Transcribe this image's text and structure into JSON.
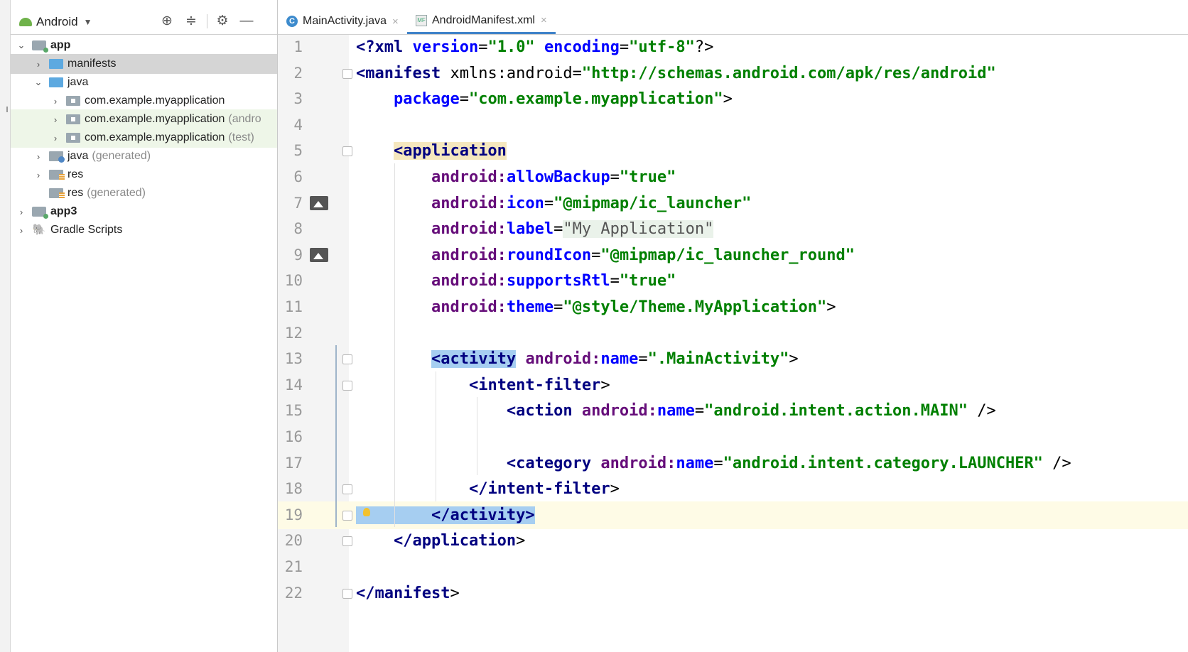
{
  "project_panel": {
    "view_selector": "Android",
    "tree": [
      {
        "label": "app",
        "suffix": "",
        "arrow": "⌄",
        "icon": "module-folder-icon",
        "bold": true,
        "state": "normal"
      },
      {
        "label": "manifests",
        "suffix": "",
        "arrow": "›",
        "icon": "manifests-folder-icon",
        "bold": false,
        "state": "selected"
      },
      {
        "label": "java",
        "suffix": "",
        "arrow": "⌄",
        "icon": "java-folder-icon",
        "bold": false,
        "state": "normal"
      },
      {
        "label": "com.example.myapplication",
        "suffix": "",
        "arrow": "›",
        "icon": "package-folder-icon",
        "bold": false,
        "state": "normal"
      },
      {
        "label": "com.example.myapplication",
        "suffix": "(andro",
        "arrow": "›",
        "icon": "package-folder-icon",
        "bold": false,
        "state": "tinted"
      },
      {
        "label": "com.example.myapplication",
        "suffix": "(test)",
        "arrow": "›",
        "icon": "package-folder-icon",
        "bold": false,
        "state": "tinted"
      },
      {
        "label": "java",
        "suffix": "(generated)",
        "arrow": "›",
        "icon": "generated-folder-icon",
        "bold": false,
        "state": "normal"
      },
      {
        "label": "res",
        "suffix": "",
        "arrow": "›",
        "icon": "res-folder-icon",
        "bold": false,
        "state": "normal"
      },
      {
        "label": "res",
        "suffix": "(generated)",
        "arrow": "",
        "icon": "res-folder-icon",
        "bold": false,
        "state": "normal"
      },
      {
        "label": "app3",
        "suffix": "",
        "arrow": "›",
        "icon": "module-folder-icon",
        "bold": true,
        "state": "normal"
      },
      {
        "label": "Gradle Scripts",
        "suffix": "",
        "arrow": "›",
        "icon": "gradle-icon",
        "bold": false,
        "state": "normal"
      }
    ]
  },
  "tabs": [
    {
      "label": "MainActivity.java",
      "icon": "C",
      "active": false
    },
    {
      "label": "AndroidManifest.xml",
      "icon": "MF",
      "active": true
    }
  ],
  "editor": {
    "current_line": 19,
    "lines": [
      {
        "n": "1",
        "code": "<?xml version=\"1.0\" encoding=\"utf-8\"?>"
      },
      {
        "n": "2",
        "code": "<manifest xmlns:android=\"http://schemas.android.com/apk/res/android\""
      },
      {
        "n": "3",
        "code": "    package=\"com.example.myapplication\">"
      },
      {
        "n": "4",
        "code": ""
      },
      {
        "n": "5",
        "code": "    <application"
      },
      {
        "n": "6",
        "code": "        android:allowBackup=\"true\""
      },
      {
        "n": "7",
        "code": "        android:icon=\"@mipmap/ic_launcher\""
      },
      {
        "n": "8",
        "code": "        android:label=\"My Application\""
      },
      {
        "n": "9",
        "code": "        android:roundIcon=\"@mipmap/ic_launcher_round\""
      },
      {
        "n": "10",
        "code": "        android:supportsRtl=\"true\""
      },
      {
        "n": "11",
        "code": "        android:theme=\"@style/Theme.MyApplication\">"
      },
      {
        "n": "12",
        "code": ""
      },
      {
        "n": "13",
        "code": "        <activity android:name=\".MainActivity\">"
      },
      {
        "n": "14",
        "code": "            <intent-filter>"
      },
      {
        "n": "15",
        "code": "                <action android:name=\"android.intent.action.MAIN\" />"
      },
      {
        "n": "16",
        "code": ""
      },
      {
        "n": "17",
        "code": "                <category android:name=\"android.intent.category.LAUNCHER\" />"
      },
      {
        "n": "18",
        "code": "            </intent-filter>"
      },
      {
        "n": "19",
        "code": "        </activity>"
      },
      {
        "n": "20",
        "code": "    </application>"
      },
      {
        "n": "21",
        "code": ""
      },
      {
        "n": "22",
        "code": "</manifest>"
      }
    ]
  },
  "colors": {
    "tag": "#000080",
    "attribute": "#0000ff",
    "namespace": "#660e7a",
    "value": "#008000",
    "current_line": "#fefbe6",
    "active_tab_underline": "#4083c9"
  }
}
